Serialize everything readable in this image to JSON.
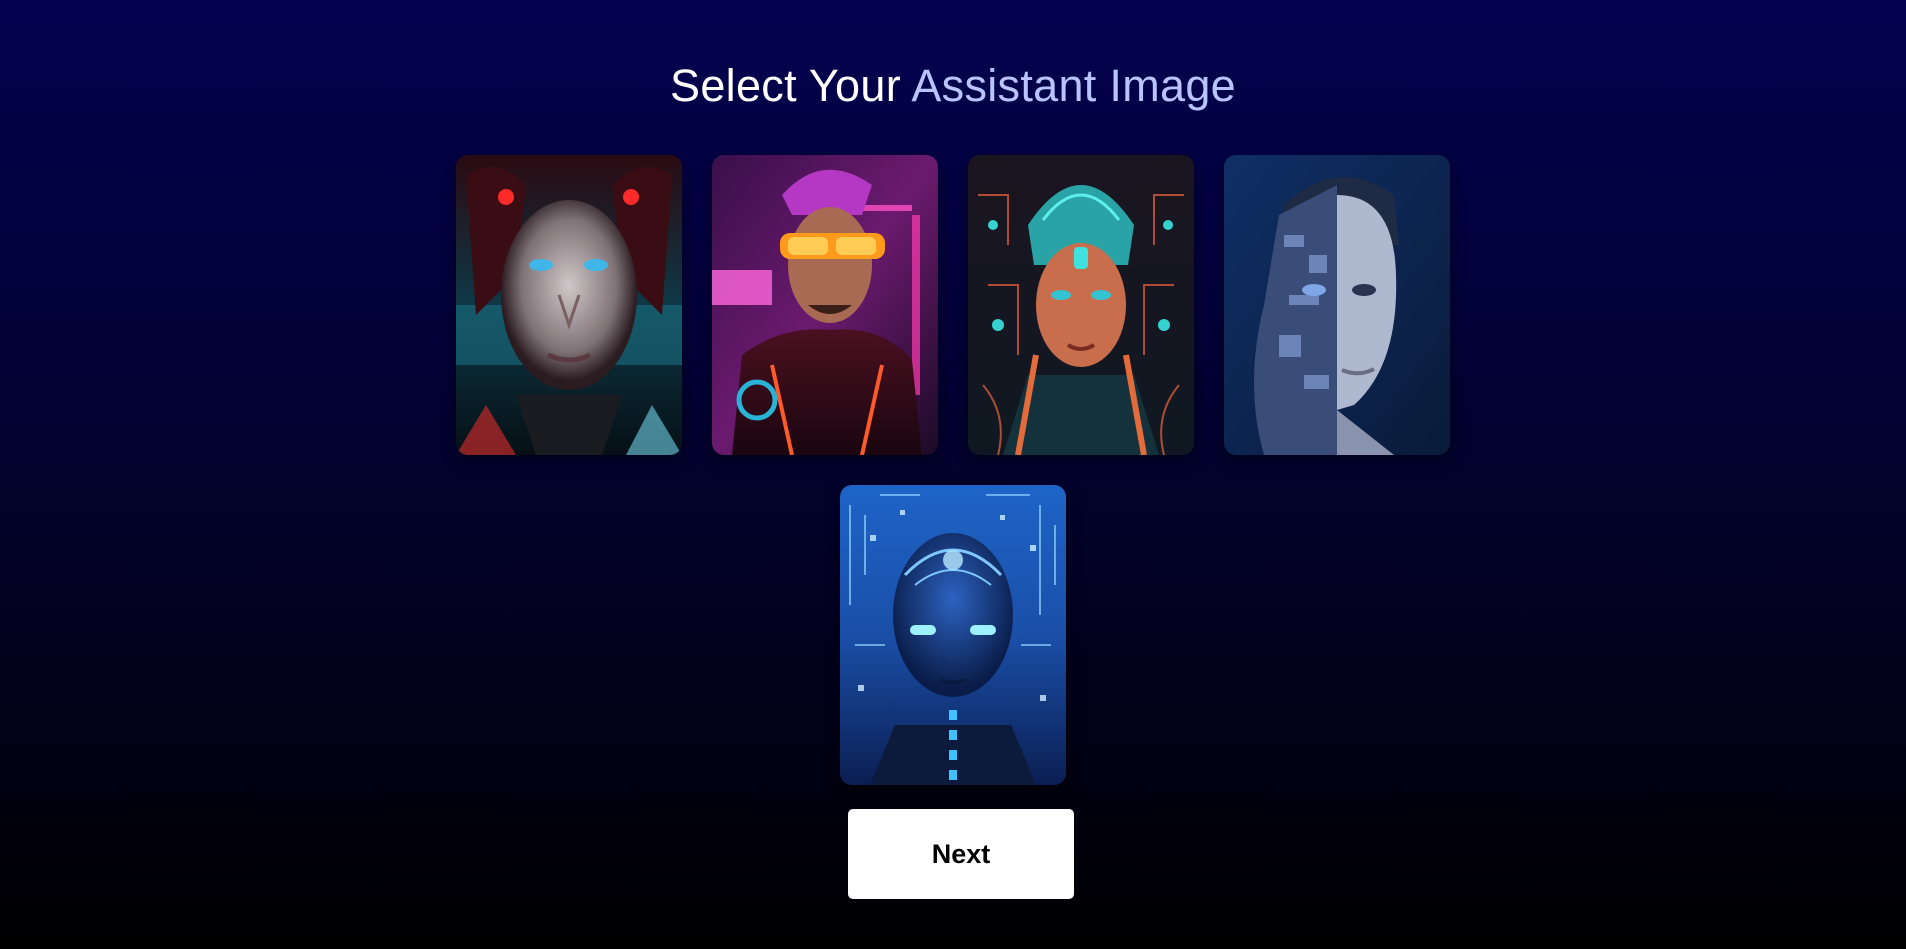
{
  "title": {
    "part1": "Select Your ",
    "part2": "Assistant Image"
  },
  "colors": {
    "title_accent": "#b9c4ff",
    "background_top": "#03024f",
    "background_bottom": "#000000"
  },
  "images": [
    {
      "name": "assistant-image-1",
      "description_icon": "cyborg-woman-red-portrait"
    },
    {
      "name": "assistant-image-2",
      "description_icon": "cyberpunk-man-orange-glasses-portrait"
    },
    {
      "name": "assistant-image-3",
      "description_icon": "circuit-woman-teal-portrait"
    },
    {
      "name": "assistant-image-4",
      "description_icon": "half-robot-man-blue-portrait"
    },
    {
      "name": "assistant-image-5",
      "description_icon": "blue-circuit-robot-portrait"
    }
  ],
  "next_button": {
    "label": "Next"
  }
}
